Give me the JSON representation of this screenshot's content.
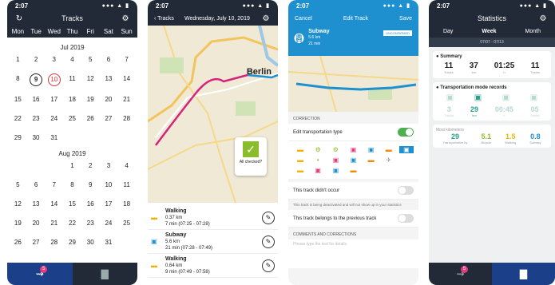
{
  "status": {
    "time": "2:07",
    "signal": "●●● ▲ ▮"
  },
  "calendar": {
    "title": "Tracks",
    "weekdays": [
      "Mon",
      "Tue",
      "Wed",
      "Thu",
      "Fri",
      "Sat",
      "Sun"
    ],
    "months": [
      {
        "name": "Jul 2019",
        "days": [
          "1",
          "2",
          "3",
          "4",
          "5",
          "6",
          "7",
          "8",
          "9",
          "10",
          "11",
          "12",
          "13",
          "14",
          "15",
          "16",
          "17",
          "18",
          "19",
          "20",
          "21",
          "22",
          "23",
          "24",
          "25",
          "26",
          "27",
          "28",
          "29",
          "30",
          "31"
        ],
        "offset": 0,
        "today": "9",
        "selected": "10"
      },
      {
        "name": "Aug 2019",
        "days": [
          "1",
          "2",
          "3",
          "4",
          "5",
          "6",
          "7",
          "8",
          "9",
          "10",
          "11",
          "12",
          "13",
          "14",
          "15",
          "16",
          "17",
          "18",
          "19",
          "20",
          "21",
          "22",
          "23",
          "24",
          "25",
          "26",
          "27",
          "28",
          "29",
          "30",
          "31"
        ],
        "offset": 3
      }
    ],
    "badge": "5"
  },
  "map_screen": {
    "back": "Tracks",
    "date": "Wednesday, July 10, 2019",
    "city": "Berlin",
    "all_checked": "All checked?",
    "entries": [
      {
        "mode": "Walking",
        "detail1": "0.37 km",
        "detail2": "7 min (07:25 - 07:28)"
      },
      {
        "mode": "Subway",
        "detail1": "5.6 km",
        "detail2": "21 min (07:28 - 07:49)"
      },
      {
        "mode": "Walking",
        "detail1": "0.64 km",
        "detail2": "9 min (07:49 - 07:58)"
      }
    ]
  },
  "edit_screen": {
    "cancel": "Cancel",
    "title": "Edit Track",
    "save": "Save",
    "mode": "Subway",
    "dist": "5.6 km",
    "dur": "21 min",
    "chip": "UNCONFIRMED",
    "section_correction": "CORRECTION",
    "edit_type": "Edit transportation type",
    "didnt_occur": "This track didn't occur",
    "note": "This track is being deactivated and will not show up in your statistics",
    "belongs_prev": "This track belongs to the previous track",
    "section_comments": "COMMENTS AND CORRECTIONS",
    "comment_placeholder": "Please type the text for details"
  },
  "stats_screen": {
    "title": "Statistics",
    "segments": [
      "Day",
      "Week",
      "Month"
    ],
    "active_segment": "Week",
    "range": "07/07 - 07/13",
    "summary_title": "Summary",
    "summary": [
      {
        "value": "11",
        "label": "Tracks"
      },
      {
        "value": "37",
        "label": "km"
      },
      {
        "value": "01:25",
        "label": "h"
      },
      {
        "value": "11",
        "label": "Tracks"
      }
    ],
    "records_title": "Transportation mode records",
    "records": [
      {
        "value": "3",
        "label": "Tracks"
      },
      {
        "value": "29",
        "label": "km"
      },
      {
        "value": "00:45",
        "label": "h"
      },
      {
        "value": "05",
        "label": "Tracks"
      }
    ],
    "most_title": "Most kilometers",
    "most": [
      {
        "value": "29",
        "label": "Transportation by",
        "color": "#2b9e8b"
      },
      {
        "value": "5.1",
        "label": "Bicycle",
        "color": "#8bbd2a"
      },
      {
        "value": "1.5",
        "label": "Walking",
        "color": "#f0b400"
      },
      {
        "value": "0.8",
        "label": "Subway",
        "color": "#1e8fcf"
      }
    ],
    "badge": "5"
  }
}
